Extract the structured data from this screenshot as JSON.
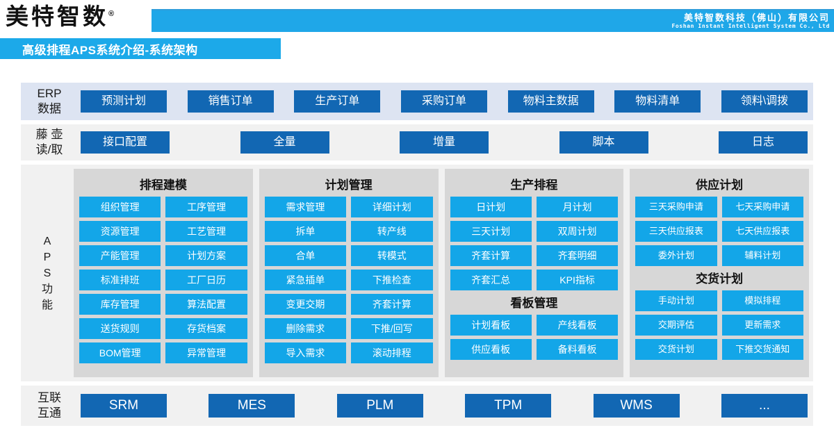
{
  "header": {
    "logo_text": "美特智数",
    "logo_registered": "®",
    "company_cn": "美特智数科技（佛山）有限公司",
    "company_en": "Foshan Instant Intelligent System Co., Ltd"
  },
  "title_banner": {
    "text": "高级排程APS系统介绍-系统架构"
  },
  "erp_row": {
    "label_line1": "ERP",
    "label_line2": "数据",
    "items": [
      "预测计划",
      "销售订单",
      "生产订单",
      "采购订单",
      "物料主数据",
      "物料清单",
      "领料\\调拨"
    ]
  },
  "read_row": {
    "label_line1": "藤 壶",
    "label_line2": "读/取",
    "items": [
      "接口配置",
      "全量",
      "增量",
      "脚本",
      "日志"
    ]
  },
  "aps": {
    "label": "A P S 功 能",
    "label_chars": [
      "A",
      "P",
      "S",
      "功",
      "能"
    ],
    "columns": [
      {
        "title": "排程建模",
        "items": [
          "组织管理",
          "工序管理",
          "资源管理",
          "工艺管理",
          "产能管理",
          "计划方案",
          "标准排班",
          "工厂日历",
          "库存管理",
          "算法配置",
          "送货规则",
          "存货档案",
          "BOM管理",
          "异常管理"
        ]
      },
      {
        "title": "计划管理",
        "items": [
          "需求管理",
          "详细计划",
          "拆单",
          "转产线",
          "合单",
          "转模式",
          "紧急插单",
          "下推检查",
          "变更交期",
          "齐套计算",
          "删除需求",
          "下推/回写",
          "导入需求",
          "滚动排程"
        ]
      },
      {
        "title": "生产排程",
        "items": [
          "日计划",
          "月计划",
          "三天计划",
          "双周计划",
          "齐套计算",
          "齐套明细",
          "齐套汇总",
          "KPI指标"
        ],
        "subtitle": "看板管理",
        "sub_items": [
          "计划看板",
          "产线看板",
          "供应看板",
          "备料看板"
        ]
      },
      {
        "title": "供应计划",
        "items": [
          "三天采购申请",
          "七天采购申请",
          "三天供应报表",
          "七天供应报表",
          "委外计划",
          "辅料计划"
        ],
        "subtitle": "交货计划",
        "sub_items": [
          "手动计划",
          "模拟排程",
          "交期评估",
          "更新需求",
          "交货计划",
          "下推交货通知"
        ]
      }
    ]
  },
  "interconnect_row": {
    "label_line1": "互联",
    "label_line2": "互通",
    "items": [
      "SRM",
      "MES",
      "PLM",
      "TPM",
      "WMS",
      "..."
    ]
  },
  "colors": {
    "brand_cyan": "#1ca9e9",
    "button_cyan": "#13a6e8",
    "button_dark_blue": "#1267b3",
    "erp_band": "#dde4f2",
    "gray_band": "#f1f1f1",
    "panel_gray": "#d7d7d7"
  }
}
